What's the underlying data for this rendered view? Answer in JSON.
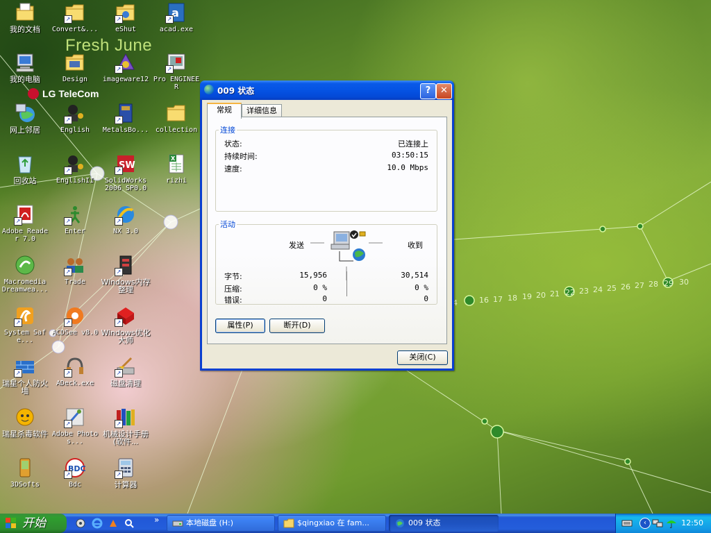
{
  "wallpaper": {
    "brand_text": "Fresh June",
    "telecom_text": "LG TeleCom",
    "numbers": [
      "4",
      "16",
      "17",
      "18",
      "19",
      "20",
      "21",
      "22",
      "23",
      "24",
      "25",
      "26",
      "27",
      "28",
      "29",
      "30"
    ]
  },
  "desktop_icons": [
    {
      "label": "我的文档",
      "icon": "my-documents-icon"
    },
    {
      "label": "Convert&...",
      "icon": "folder-icon"
    },
    {
      "label": "eShut",
      "icon": "eshut-icon"
    },
    {
      "label": "acad.exe",
      "icon": "autocad-icon"
    },
    {
      "label": "我的电脑",
      "icon": "my-computer-icon"
    },
    {
      "label": "Design",
      "icon": "design-icon"
    },
    {
      "label": "imageware12",
      "icon": "imageware-icon"
    },
    {
      "label": "Pro ENGINEER",
      "icon": "proe-icon"
    },
    {
      "label": "网上邻居",
      "icon": "network-places-icon"
    },
    {
      "label": "English",
      "icon": "english-icon"
    },
    {
      "label": "MetalsBo...",
      "icon": "metals-book-icon"
    },
    {
      "label": "collection",
      "icon": "folder-icon"
    },
    {
      "label": "回收站",
      "icon": "recycle-bin-icon"
    },
    {
      "label": "EnglishII",
      "icon": "english-icon"
    },
    {
      "label": "SolidWorks 2006 SP0.0",
      "icon": "solidworks-icon"
    },
    {
      "label": "rizhi",
      "icon": "excel-icon"
    },
    {
      "label": "Adobe Reader 7.0",
      "icon": "adobe-reader-icon"
    },
    {
      "label": "Enter",
      "icon": "enter-icon"
    },
    {
      "label": "NX 3.0",
      "icon": "nx-icon"
    },
    {
      "label": "Macromedia Dreamwea...",
      "icon": "dreamweaver-icon"
    },
    {
      "label": "Trade",
      "icon": "trade-icon"
    },
    {
      "label": "Windows内存整理",
      "icon": "memory-tool-icon"
    },
    {
      "label": "System Safe...",
      "icon": "system-safe-icon"
    },
    {
      "label": "ACDSee v8.0",
      "icon": "acdsee-icon"
    },
    {
      "label": "Windows优化大师",
      "icon": "optimizer-icon"
    },
    {
      "label": "瑞星个人防火墙",
      "icon": "firewall-icon"
    },
    {
      "label": "ADeck.exe",
      "icon": "adeck-icon"
    },
    {
      "label": "磁盘清理",
      "icon": "disk-cleanup-icon"
    },
    {
      "label": "瑞星杀毒软件",
      "icon": "antivirus-icon"
    },
    {
      "label": "Adobe Photos...",
      "icon": "photoshop-icon"
    },
    {
      "label": "机械设计手册(软件...",
      "icon": "books-icon"
    },
    {
      "label": "3DSofts",
      "icon": "3dsofts-icon"
    },
    {
      "label": "Bdc",
      "icon": "bdc-icon"
    },
    {
      "label": "计算器",
      "icon": "calculator-icon"
    }
  ],
  "dialog": {
    "title": "009 状态",
    "tabs": [
      "常规",
      "详细信息"
    ],
    "connection": {
      "legend": "连接",
      "rows": [
        {
          "label": "状态:",
          "value": "已连接上"
        },
        {
          "label": "持续时间:",
          "value": "03:50:15"
        },
        {
          "label": "速度:",
          "value": "10.0 Mbps"
        }
      ]
    },
    "activity": {
      "legend": "活动",
      "sent_label": "发送",
      "received_label": "收到",
      "rows": [
        {
          "label": "字节:",
          "sent": "15,956",
          "received": "30,514"
        },
        {
          "label": "压缩:",
          "sent": "0 %",
          "received": "0 %"
        },
        {
          "label": "错误:",
          "sent": "0",
          "received": "0"
        }
      ]
    },
    "properties_button": "属性(P)",
    "disconnect_button": "断开(D)",
    "close_button": "关闭(C)"
  },
  "taskbar": {
    "start_label": "开始",
    "chevron": "»",
    "tasks": [
      {
        "label": "本地磁盘 (H:)",
        "active": false
      },
      {
        "label": "$qingxiao 在 fam...",
        "active": false
      },
      {
        "label": "009 状态",
        "active": true
      }
    ],
    "clock": "12:50"
  }
}
